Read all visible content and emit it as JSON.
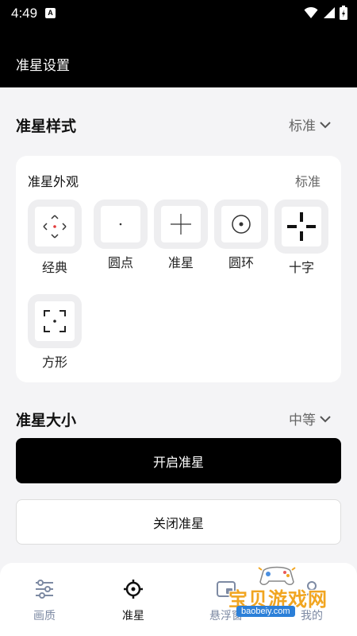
{
  "status_bar": {
    "time": "4:49",
    "notification_badge": "A"
  },
  "header": {
    "title": "准星设置"
  },
  "style_section": {
    "title": "准星样式",
    "selected": "标准",
    "card": {
      "title": "外观",
      "title_full": "准星外观",
      "value": "标准",
      "options": [
        {
          "label": "经典",
          "icon": "classic-crosshair"
        },
        {
          "label": "圆点",
          "icon": "dot-crosshair"
        },
        {
          "label": "准星",
          "icon": "cross-crosshair"
        },
        {
          "label": "圆环",
          "icon": "ring-crosshair"
        },
        {
          "label": "十字",
          "icon": "plus-crosshair"
        },
        {
          "label": "方形",
          "icon": "square-crosshair"
        }
      ]
    }
  },
  "size_section": {
    "title": "准星大小",
    "selected": "中等"
  },
  "buttons": {
    "enable": "开启准星",
    "disable": "关闭准星"
  },
  "bottom_nav": [
    {
      "label": "画质",
      "icon": "sliders-icon",
      "color": "#7d8aa3"
    },
    {
      "label": "准星",
      "icon": "crosshair-icon",
      "color": "#111111"
    },
    {
      "label": "悬浮窗",
      "icon": "floating-window-icon",
      "color": "#7d8aa3"
    },
    {
      "label": "我的",
      "icon": "profile-icon",
      "color": "#7d8aa3"
    }
  ],
  "watermark": {
    "title": "宝贝游戏网",
    "url": "baobeiy.com"
  }
}
